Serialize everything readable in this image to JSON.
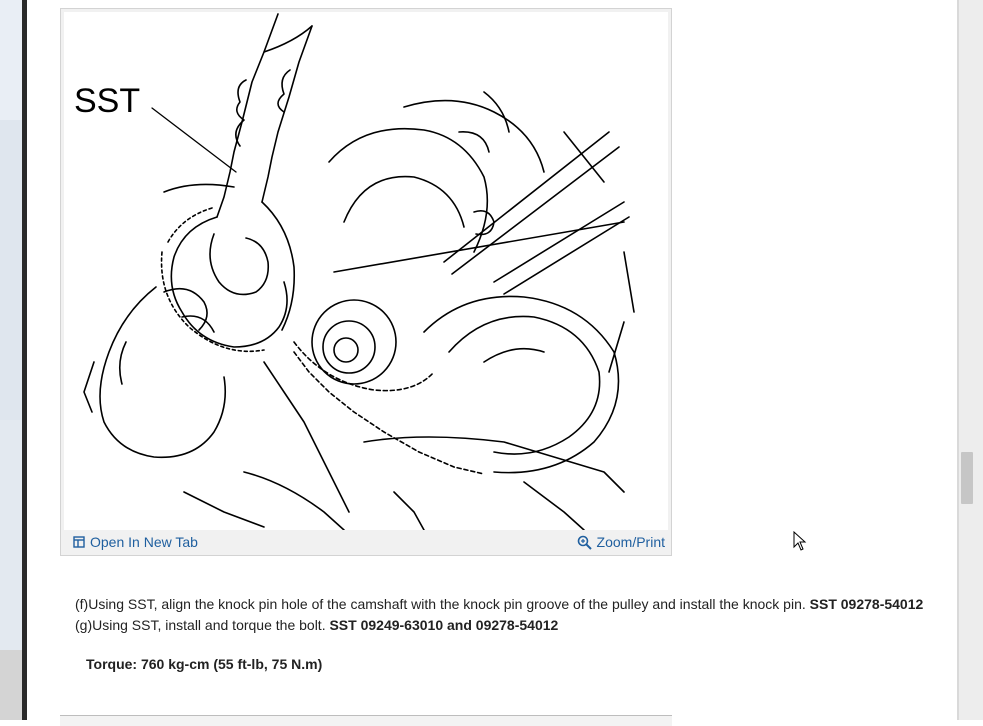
{
  "figure": {
    "sst_label": "SST",
    "open_tab_label": "Open In New Tab",
    "zoom_label": "Zoom/Print",
    "open_tab_icon": "open-in-new-tab-icon",
    "zoom_icon": "magnifier-icon"
  },
  "steps": {
    "f_text": "(f)Using SST, align the knock pin hole of the camshaft with the knock pin groove of the pulley and install the knock pin. ",
    "f_tool": "SST 09278-54012",
    "g_text": "(g)Using SST, install and torque the bolt. ",
    "g_tool": "SST 09249-63010 and 09278-54012"
  },
  "torque": "Torque: 760 kg-cm (55 ft-lb, 75 N.m)",
  "colors": {
    "link": "#1f5f9f",
    "text": "#222222"
  }
}
